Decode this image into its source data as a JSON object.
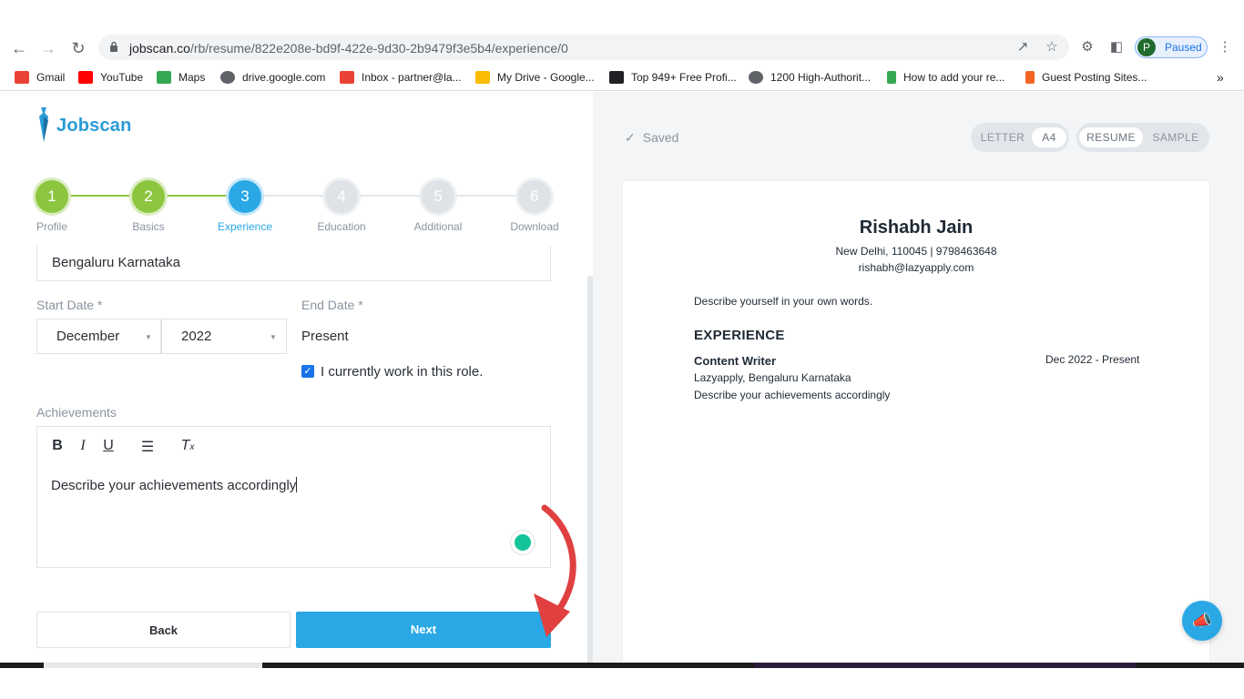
{
  "browser": {
    "url_host": "jobscan.co",
    "url_path": "/rb/resume/822e208e-bd9f-422e-9d30-2b9479f3e5b4/experience/0",
    "profile_initial": "P",
    "profile_status": "Paused"
  },
  "bookmarks": [
    {
      "label": "Gmail",
      "color": "#ea4335"
    },
    {
      "label": "YouTube",
      "color": "#ff0000"
    },
    {
      "label": "Maps",
      "color": "#34a853"
    },
    {
      "label": "drive.google.com",
      "color": "#5f6368"
    },
    {
      "label": "Inbox - partner@la...",
      "color": "#ea4335"
    },
    {
      "label": "My Drive - Google...",
      "color": "#fbbc04"
    },
    {
      "label": "Top 949+ Free Profi...",
      "color": "#202124"
    },
    {
      "label": "1200 High-Authorit...",
      "color": "#5f6368"
    },
    {
      "label": "How to add your re...",
      "color": "#34a853"
    },
    {
      "label": "Guest Posting Sites...",
      "color": "#f26522"
    }
  ],
  "app": {
    "logo_text": "Jobscan",
    "steps": [
      {
        "num": "1",
        "label": "Profile",
        "state": "done"
      },
      {
        "num": "2",
        "label": "Basics",
        "state": "done"
      },
      {
        "num": "3",
        "label": "Experience",
        "state": "active"
      },
      {
        "num": "4",
        "label": "Education",
        "state": "todo"
      },
      {
        "num": "5",
        "label": "Additional",
        "state": "todo"
      },
      {
        "num": "6",
        "label": "Download",
        "state": "todo"
      }
    ],
    "location_value": "Bengaluru Karnataka",
    "start_date_label": "Start Date *",
    "end_date_label": "End Date *",
    "start_month": "December",
    "start_year": "2022",
    "end_value": "Present",
    "current_role_label": "I currently work in this role.",
    "current_role_checked": true,
    "achievements_label": "Achievements",
    "achievements_text": "Describe your achievements accordingly",
    "back_label": "Back",
    "next_label": "Next"
  },
  "preview": {
    "saved_label": "Saved",
    "paper_sizes": [
      "LETTER",
      "A4"
    ],
    "paper_active": "A4",
    "view_modes": [
      "RESUME",
      "SAMPLE"
    ],
    "view_active": "RESUME",
    "name": "Rishabh Jain",
    "contact_line": "New Delhi, 110045 | 9798463648",
    "email": "rishabh@lazyapply.com",
    "summary": "Describe yourself in your own words.",
    "section_heading": "EXPERIENCE",
    "job_title": "Content Writer",
    "job_dates": "Dec 2022 - Present",
    "company_line": "Lazyapply, Bengaluru Karnataka",
    "job_achievements": "Describe your achievements accordingly"
  },
  "colors": {
    "brand": "#2aa8e6",
    "step_done": "#8cc63f",
    "step_active": "#2aa8e6",
    "step_todo": "#dfe3e8"
  }
}
